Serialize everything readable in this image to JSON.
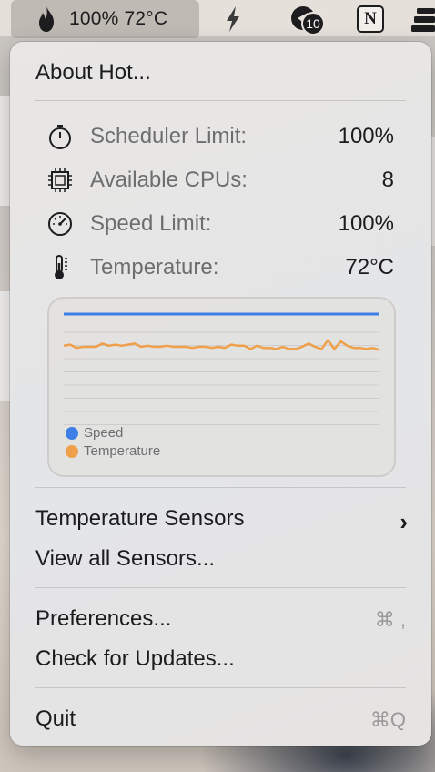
{
  "menubar": {
    "status_text": "100% 72°C",
    "badge_count": "10",
    "notion_letter": "N"
  },
  "menu": {
    "about_label": "About Hot...",
    "stats": [
      {
        "label": "Scheduler Limit:",
        "value": "100%",
        "icon": "stopwatch-icon"
      },
      {
        "label": "Available CPUs:",
        "value": "8",
        "icon": "cpu-icon"
      },
      {
        "label": "Speed Limit:",
        "value": "100%",
        "icon": "gauge-icon"
      },
      {
        "label": "Temperature:",
        "value": "72°C",
        "icon": "thermometer-icon"
      }
    ],
    "temperature_sensors_label": "Temperature Sensors",
    "view_all_sensors_label": "View all Sensors...",
    "preferences_label": "Preferences...",
    "preferences_shortcut": "⌘ ,",
    "check_updates_label": "Check for Updates...",
    "quit_label": "Quit",
    "quit_shortcut": "⌘Q"
  },
  "chart_data": {
    "type": "line",
    "ylim": [
      0,
      100
    ],
    "grid": true,
    "legend": "bottom-left",
    "series": [
      {
        "name": "Speed",
        "color": "#3d7fe6",
        "values": [
          100,
          100,
          100,
          100,
          100,
          100,
          100,
          100,
          100,
          100,
          100,
          100,
          100,
          100,
          100,
          100,
          100,
          100,
          100,
          100,
          100,
          100,
          100,
          100,
          100,
          100,
          100,
          100,
          100,
          100,
          100,
          100,
          100,
          100,
          100,
          100,
          100,
          100,
          100,
          100,
          100,
          100,
          100,
          100,
          100,
          100,
          100,
          100,
          100,
          100
        ]
      },
      {
        "name": "Temperature",
        "color": "#f0a04a",
        "values": [
          71,
          72,
          69,
          70,
          70,
          70,
          73,
          71,
          72,
          71,
          72,
          73,
          70,
          71,
          70,
          70,
          71,
          70,
          70,
          70,
          69,
          70,
          70,
          69,
          70,
          69,
          72,
          71,
          71,
          68,
          71,
          69,
          69,
          68,
          70,
          68,
          68,
          70,
          73,
          70,
          68,
          76,
          68,
          75,
          71,
          69,
          69,
          68,
          69,
          67
        ]
      }
    ]
  }
}
